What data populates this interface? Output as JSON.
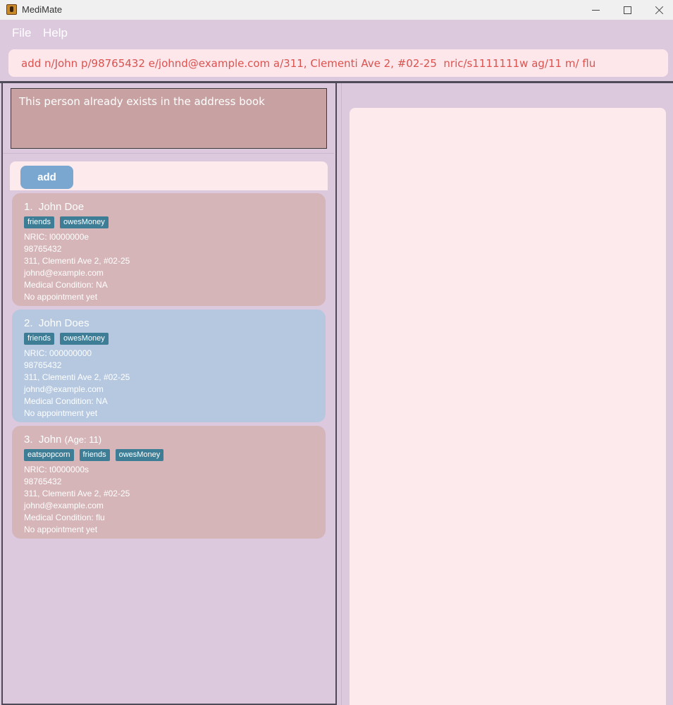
{
  "window": {
    "title": "MediMate"
  },
  "menu": {
    "file": "File",
    "help": "Help"
  },
  "command": {
    "value": "add n/John p/98765432 e/johnd@example.com a/311, Clementi Ave 2, #02-25  nric/s1111111w ag/11 m/ flu"
  },
  "result": {
    "message": "This person already exists in the address book"
  },
  "toolbar": {
    "add_label": "add"
  },
  "persons": [
    {
      "index": "1.",
      "name": "John Doe",
      "age": "",
      "tags": [
        "friends",
        "owesMoney"
      ],
      "nric": "NRIC: l0000000e",
      "phone": "98765432",
      "address": "311, Clementi Ave 2, #02-25",
      "email": "johnd@example.com",
      "condition": "Medical Condition: NA",
      "appointment": "No appointment yet",
      "color": "#d5b5b7"
    },
    {
      "index": "2.",
      "name": "John Does",
      "age": "",
      "tags": [
        "friends",
        "owesMoney"
      ],
      "nric": "NRIC: 000000000",
      "phone": "98765432",
      "address": "311, Clementi Ave 2, #02-25",
      "email": "johnd@example.com",
      "condition": "Medical Condition: NA",
      "appointment": "No appointment yet",
      "color": "#b5c8e0"
    },
    {
      "index": "3.",
      "name": "John",
      "age": "(Age: 11)",
      "tags": [
        "eatspopcorn",
        "friends",
        "owesMoney"
      ],
      "nric": "NRIC: t0000000s",
      "phone": "98765432",
      "address": "311, Clementi Ave 2, #02-25",
      "email": "johnd@example.com",
      "condition": "Medical Condition: flu",
      "appointment": "No appointment yet",
      "color": "#d5b5b7"
    }
  ],
  "colors": {
    "background": "#dcc9de",
    "panel": "#fdeaed",
    "command_text": "#d9534f",
    "tag": "#3d7d95",
    "button": "#7aa7cf"
  }
}
